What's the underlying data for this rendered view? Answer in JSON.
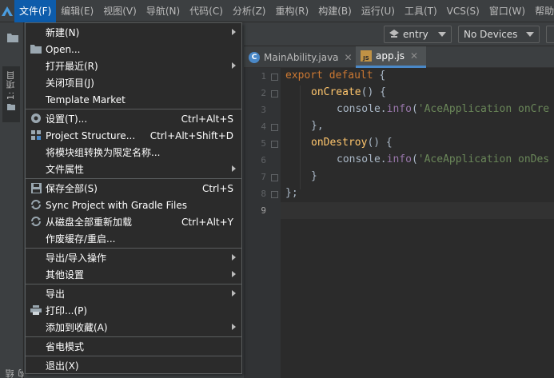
{
  "menubar": {
    "items": [
      {
        "label": "文件(F)",
        "active": true
      },
      {
        "label": "编辑(E)"
      },
      {
        "label": "视图(V)"
      },
      {
        "label": "导航(N)"
      },
      {
        "label": "代码(C)"
      },
      {
        "label": "分析(Z)"
      },
      {
        "label": "重构(R)"
      },
      {
        "label": "构建(B)"
      },
      {
        "label": "运行(U)"
      },
      {
        "label": "工具(T)"
      },
      {
        "label": "VCS(S)"
      },
      {
        "label": "窗口(W)"
      },
      {
        "label": "帮助"
      }
    ]
  },
  "left_strip": {
    "project_tab": "1: 项目",
    "bottom_label": "结构"
  },
  "toolbar": {
    "module_combo": "entry",
    "device_combo": "No Devices"
  },
  "tabs": [
    {
      "label": "MainAbility.java",
      "icon": "java-class-icon",
      "active": false
    },
    {
      "label": "app.js",
      "icon": "js-file-icon",
      "active": true
    }
  ],
  "editor": {
    "line_numbers": [
      "1",
      "2",
      "3",
      "4",
      "5",
      "6",
      "7",
      "8",
      "9"
    ],
    "current_line": 9
  },
  "file_menu": {
    "items": [
      {
        "label": "新建(N)",
        "shortcut": "",
        "submenu": true,
        "icon": ""
      },
      {
        "label": "Open...",
        "shortcut": "",
        "submenu": false,
        "icon": "folder-icon"
      },
      {
        "label": "打开最近(R)",
        "shortcut": "",
        "submenu": true,
        "icon": ""
      },
      {
        "label": "关闭项目(J)",
        "shortcut": "",
        "submenu": false,
        "icon": ""
      },
      {
        "label": "Template Market",
        "shortcut": "",
        "submenu": false,
        "icon": ""
      },
      {
        "label": "设置(T)...",
        "shortcut": "Ctrl+Alt+S",
        "submenu": false,
        "icon": "gear-icon"
      },
      {
        "label": "Project Structure...",
        "shortcut": "Ctrl+Alt+Shift+D",
        "submenu": false,
        "icon": "project-structure-icon"
      },
      {
        "label": "将模块组转换为限定名称...",
        "shortcut": "",
        "submenu": false,
        "icon": ""
      },
      {
        "label": "文件属性",
        "shortcut": "",
        "submenu": true,
        "icon": ""
      },
      {
        "label": "保存全部(S)",
        "shortcut": "Ctrl+S",
        "submenu": false,
        "icon": "save-icon"
      },
      {
        "label": "Sync Project with Gradle Files",
        "shortcut": "",
        "submenu": false,
        "icon": "sync-icon"
      },
      {
        "label": "从磁盘全部重新加载",
        "shortcut": "Ctrl+Alt+Y",
        "submenu": false,
        "icon": "reload-icon"
      },
      {
        "label": "作废缓存/重启...",
        "shortcut": "",
        "submenu": false,
        "icon": ""
      },
      {
        "label": "导出/导入操作",
        "shortcut": "",
        "submenu": true,
        "icon": ""
      },
      {
        "label": "其他设置",
        "shortcut": "",
        "submenu": true,
        "icon": ""
      },
      {
        "label": "导出",
        "shortcut": "",
        "submenu": true,
        "icon": ""
      },
      {
        "label": "打印...(P)",
        "shortcut": "",
        "submenu": false,
        "icon": "print-icon"
      },
      {
        "label": "添加到收藏(A)",
        "shortcut": "",
        "submenu": true,
        "icon": ""
      },
      {
        "label": "省电模式",
        "shortcut": "",
        "submenu": false,
        "icon": ""
      },
      {
        "label": "退出(X)",
        "shortcut": "",
        "submenu": false,
        "icon": ""
      }
    ]
  },
  "code": {
    "l1_kw": "export default",
    "l1_brace": "{",
    "l2_fn": "onCreate",
    "l2_rest": "() {",
    "l3_obj": "console.",
    "l3_fn": "info",
    "l3_open": "(",
    "l3_str": "'AceApplication onCre",
    "l4": "},",
    "l5_fn": "onDestroy",
    "l5_rest": "() {",
    "l6_obj": "console.",
    "l6_fn": "info",
    "l6_open": "(",
    "l6_str": "'AceApplication onDes",
    "l7": "}",
    "l8": "};"
  },
  "colors": {
    "menu_active": "#0d5cab",
    "editor_bg": "#2b2b2b",
    "keyword": "#cc7832",
    "function": "#ffc66d",
    "string": "#6a8759"
  }
}
